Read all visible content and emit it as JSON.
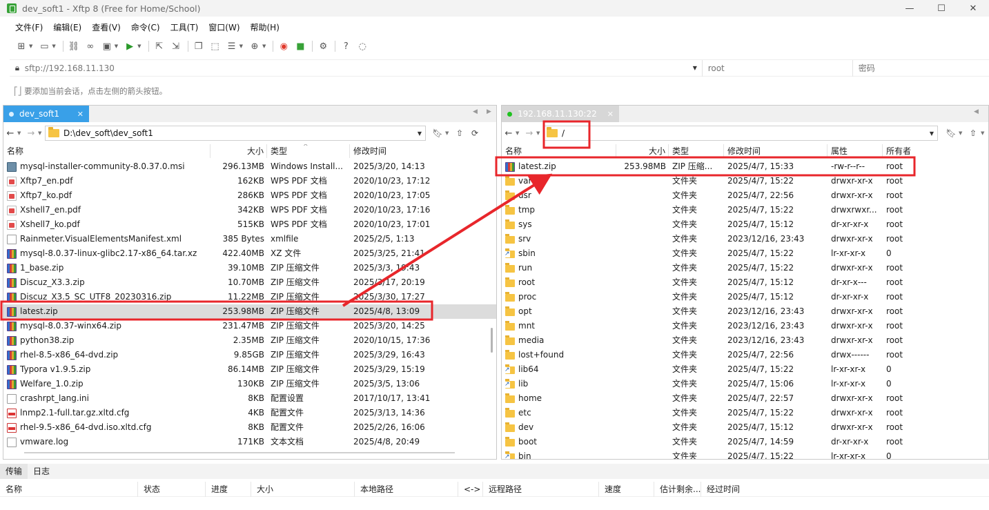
{
  "window": {
    "title": "dev_soft1 - Xftp 8 (Free for Home/School)",
    "controls": [
      "—",
      "☐",
      "✕"
    ]
  },
  "menu": [
    "文件(F)",
    "编辑(E)",
    "查看(V)",
    "命令(C)",
    "工具(T)",
    "窗口(W)",
    "帮助(H)"
  ],
  "address": {
    "value": "sftp://192.168.11.130",
    "user_placeholder": "root",
    "password_placeholder": "密码"
  },
  "hint": "要添加当前会话，点击左侧的箭头按钮。",
  "left_pane": {
    "tab_label": "dev_soft1",
    "path": "D:\\dev_soft\\dev_soft1",
    "columns": [
      "名称",
      "大小",
      "类型",
      "修改时间"
    ],
    "files": [
      {
        "icon": "msi",
        "name": "mysql-installer-community-8.0.37.0.msi",
        "size": "296.13MB",
        "type": "Windows Install...",
        "modified": "2025/3/20, 14:13"
      },
      {
        "icon": "pdf",
        "name": "Xftp7_en.pdf",
        "size": "162KB",
        "type": "WPS PDF 文档",
        "modified": "2020/10/23, 17:12"
      },
      {
        "icon": "pdf",
        "name": "Xftp7_ko.pdf",
        "size": "286KB",
        "type": "WPS PDF 文档",
        "modified": "2020/10/23, 17:05"
      },
      {
        "icon": "pdf",
        "name": "Xshell7_en.pdf",
        "size": "342KB",
        "type": "WPS PDF 文档",
        "modified": "2020/10/23, 17:16"
      },
      {
        "icon": "pdf",
        "name": "Xshell7_ko.pdf",
        "size": "515KB",
        "type": "WPS PDF 文档",
        "modified": "2020/10/23, 17:01"
      },
      {
        "icon": "doc",
        "name": "Rainmeter.VisualElementsManifest.xml",
        "size": "385 Bytes",
        "type": "xmlfile",
        "modified": "2025/2/5, 1:13"
      },
      {
        "icon": "zip",
        "name": "mysql-8.0.37-linux-glibc2.17-x86_64.tar.xz",
        "size": "422.40MB",
        "type": "XZ 文件",
        "modified": "2025/3/25, 21:41"
      },
      {
        "icon": "zip",
        "name": "1_base.zip",
        "size": "39.10MB",
        "type": "ZIP 压缩文件",
        "modified": "2025/3/3, 19:43"
      },
      {
        "icon": "zip",
        "name": "Discuz_X3.3.zip",
        "size": "10.70MB",
        "type": "ZIP 压缩文件",
        "modified": "2025/3/17, 20:19"
      },
      {
        "icon": "zip",
        "name": "Discuz_X3.5_SC_UTF8_20230316.zip",
        "size": "11.22MB",
        "type": "ZIP 压缩文件",
        "modified": "2025/3/30, 17:27"
      },
      {
        "icon": "zip",
        "name": "latest.zip",
        "size": "253.98MB",
        "type": "ZIP 压缩文件",
        "modified": "2025/4/8, 13:09",
        "selected": true
      },
      {
        "icon": "zip",
        "name": "mysql-8.0.37-winx64.zip",
        "size": "231.47MB",
        "type": "ZIP 压缩文件",
        "modified": "2025/3/20, 14:25"
      },
      {
        "icon": "zip",
        "name": "python38.zip",
        "size": "2.35MB",
        "type": "ZIP 压缩文件",
        "modified": "2020/10/15, 17:36"
      },
      {
        "icon": "zip",
        "name": "rhel-8.5-x86_64-dvd.zip",
        "size": "9.85GB",
        "type": "ZIP 压缩文件",
        "modified": "2025/3/29, 16:43"
      },
      {
        "icon": "zip",
        "name": "Typora v1.9.5.zip",
        "size": "86.14MB",
        "type": "ZIP 压缩文件",
        "modified": "2025/3/29, 15:19"
      },
      {
        "icon": "zip",
        "name": "Welfare_1.0.zip",
        "size": "130KB",
        "type": "ZIP 压缩文件",
        "modified": "2025/3/5, 13:06"
      },
      {
        "icon": "doc",
        "name": "crashrpt_lang.ini",
        "size": "8KB",
        "type": "配置设置",
        "modified": "2017/10/17, 13:41"
      },
      {
        "icon": "cfg",
        "name": "lnmp2.1-full.tar.gz.xltd.cfg",
        "size": "4KB",
        "type": "配置文件",
        "modified": "2025/3/13, 14:36"
      },
      {
        "icon": "cfg",
        "name": "rhel-9.5-x86_64-dvd.iso.xltd.cfg",
        "size": "8KB",
        "type": "配置文件",
        "modified": "2025/2/26, 16:06"
      },
      {
        "icon": "doc",
        "name": "vmware.log",
        "size": "171KB",
        "type": "文本文档",
        "modified": "2025/4/8, 20:49"
      }
    ]
  },
  "right_pane": {
    "tab_label": "192.168.11.130:22",
    "path": "/",
    "columns": [
      "名称",
      "大小",
      "类型",
      "修改时间",
      "属性",
      "所有者"
    ],
    "files": [
      {
        "icon": "zip",
        "name": "latest.zip",
        "size": "253.98MB",
        "type": "ZIP 压缩...",
        "modified": "2025/4/7, 15:33",
        "attr": "-rw-r--r--",
        "owner": "root"
      },
      {
        "icon": "folder",
        "name": "var",
        "size": "",
        "type": "文件夹",
        "modified": "2025/4/7, 15:22",
        "attr": "drwxr-xr-x",
        "owner": "root"
      },
      {
        "icon": "folder",
        "name": "usr",
        "size": "",
        "type": "文件夹",
        "modified": "2025/4/7, 22:56",
        "attr": "drwxr-xr-x",
        "owner": "root"
      },
      {
        "icon": "folder",
        "name": "tmp",
        "size": "",
        "type": "文件夹",
        "modified": "2025/4/7, 15:22",
        "attr": "drwxrwxr...",
        "owner": "root"
      },
      {
        "icon": "folder",
        "name": "sys",
        "size": "",
        "type": "文件夹",
        "modified": "2025/4/7, 15:12",
        "attr": "dr-xr-xr-x",
        "owner": "root"
      },
      {
        "icon": "folder",
        "name": "srv",
        "size": "",
        "type": "文件夹",
        "modified": "2023/12/16, 23:43",
        "attr": "drwxr-xr-x",
        "owner": "root"
      },
      {
        "icon": "link",
        "name": "sbin",
        "size": "",
        "type": "文件夹",
        "modified": "2025/4/7, 15:22",
        "attr": "lr-xr-xr-x",
        "owner": "0"
      },
      {
        "icon": "folder",
        "name": "run",
        "size": "",
        "type": "文件夹",
        "modified": "2025/4/7, 15:22",
        "attr": "drwxr-xr-x",
        "owner": "root"
      },
      {
        "icon": "folder",
        "name": "root",
        "size": "",
        "type": "文件夹",
        "modified": "2025/4/7, 15:12",
        "attr": "dr-xr-x---",
        "owner": "root"
      },
      {
        "icon": "folder",
        "name": "proc",
        "size": "",
        "type": "文件夹",
        "modified": "2025/4/7, 15:12",
        "attr": "dr-xr-xr-x",
        "owner": "root"
      },
      {
        "icon": "folder",
        "name": "opt",
        "size": "",
        "type": "文件夹",
        "modified": "2023/12/16, 23:43",
        "attr": "drwxr-xr-x",
        "owner": "root"
      },
      {
        "icon": "folder",
        "name": "mnt",
        "size": "",
        "type": "文件夹",
        "modified": "2023/12/16, 23:43",
        "attr": "drwxr-xr-x",
        "owner": "root"
      },
      {
        "icon": "folder",
        "name": "media",
        "size": "",
        "type": "文件夹",
        "modified": "2023/12/16, 23:43",
        "attr": "drwxr-xr-x",
        "owner": "root"
      },
      {
        "icon": "folder",
        "name": "lost+found",
        "size": "",
        "type": "文件夹",
        "modified": "2025/4/7, 22:56",
        "attr": "drwx------",
        "owner": "root"
      },
      {
        "icon": "link",
        "name": "lib64",
        "size": "",
        "type": "文件夹",
        "modified": "2025/4/7, 15:22",
        "attr": "lr-xr-xr-x",
        "owner": "0"
      },
      {
        "icon": "link",
        "name": "lib",
        "size": "",
        "type": "文件夹",
        "modified": "2025/4/7, 15:06",
        "attr": "lr-xr-xr-x",
        "owner": "0"
      },
      {
        "icon": "folder",
        "name": "home",
        "size": "",
        "type": "文件夹",
        "modified": "2025/4/7, 22:57",
        "attr": "drwxr-xr-x",
        "owner": "root"
      },
      {
        "icon": "folder",
        "name": "etc",
        "size": "",
        "type": "文件夹",
        "modified": "2025/4/7, 15:22",
        "attr": "drwxr-xr-x",
        "owner": "root"
      },
      {
        "icon": "folder",
        "name": "dev",
        "size": "",
        "type": "文件夹",
        "modified": "2025/4/7, 15:12",
        "attr": "drwxr-xr-x",
        "owner": "root"
      },
      {
        "icon": "folder",
        "name": "boot",
        "size": "",
        "type": "文件夹",
        "modified": "2025/4/7, 14:59",
        "attr": "dr-xr-xr-x",
        "owner": "root"
      },
      {
        "icon": "link",
        "name": "bin",
        "size": "",
        "type": "文件夹",
        "modified": "2025/4/7, 15:22",
        "attr": "lr-xr-xr-x",
        "owner": "0"
      }
    ]
  },
  "bottom": {
    "tabs": [
      "传输",
      "日志"
    ],
    "columns": [
      "名称",
      "状态",
      "进度",
      "大小",
      "本地路径",
      "<->",
      "远程路径",
      "速度",
      "估计剩余...",
      "经过时间"
    ]
  },
  "colors": {
    "accent": "#39a0e8",
    "annotation": "#e8262b",
    "connected": "#1fc21f"
  }
}
